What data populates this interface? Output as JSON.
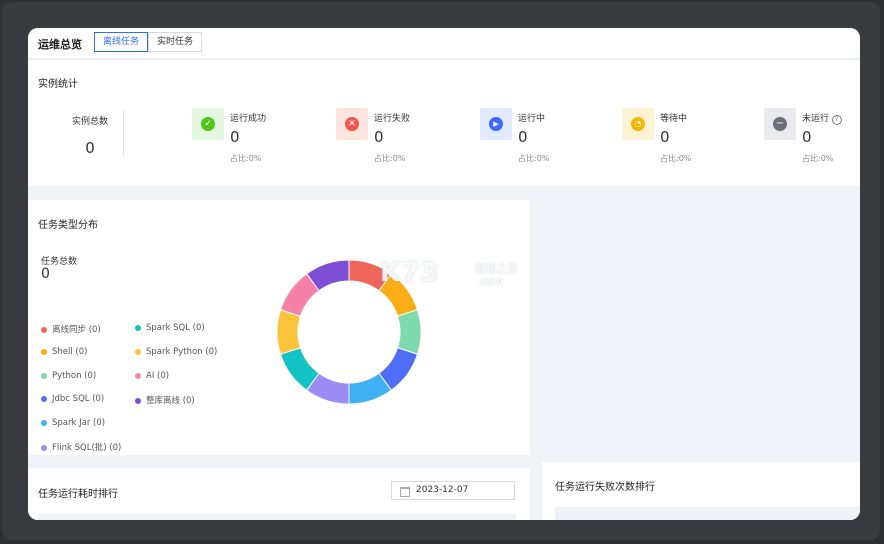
{
  "header": {
    "title": "运维总览",
    "tabs": [
      {
        "label": "离线任务",
        "active": true
      },
      {
        "label": "实时任务",
        "active": false
      }
    ]
  },
  "stats": {
    "title": "实例统计",
    "total_label": "实例总数",
    "total_value": "0",
    "items": [
      {
        "name": "运行成功",
        "value": "0",
        "ratio": "占比:0%",
        "icon": "check-icon",
        "bg": "#e6f7e1",
        "color": "#52c41a"
      },
      {
        "name": "运行失败",
        "value": "0",
        "ratio": "占比:0%",
        "icon": "close-icon",
        "bg": "#fde4e1",
        "color": "#f5564a"
      },
      {
        "name": "运行中",
        "value": "0",
        "ratio": "占比:0%",
        "icon": "play-icon",
        "bg": "#e3e9ff",
        "color": "#3d6bff"
      },
      {
        "name": "等待中",
        "value": "0",
        "ratio": "占比:0%",
        "icon": "clock-icon",
        "bg": "#fff3d6",
        "color": "#f7b500"
      },
      {
        "name": "未运行",
        "value": "0",
        "ratio": "占比:0%",
        "icon": "minus-icon",
        "bg": "#e9eaed",
        "color": "#6b6f78"
      }
    ]
  },
  "distribution": {
    "title": "任务类型分布",
    "total_label": "任务总数",
    "total_value": "0",
    "legend": [
      {
        "label": "离线同步 (0)",
        "color": "#f0655a"
      },
      {
        "label": "Spark SQL (0)",
        "color": "#13c2c2"
      },
      {
        "label": "Shell (0)",
        "color": "#faad14"
      },
      {
        "label": "Spark Python (0)",
        "color": "#fcc43c"
      },
      {
        "label": "Python (0)",
        "color": "#7ed9ad"
      },
      {
        "label": "AI (0)",
        "color": "#f580a8"
      },
      {
        "label": "Jdbc SQL (0)",
        "color": "#4d6ef5"
      },
      {
        "label": "整库离线 (0)",
        "color": "#7e4fd6"
      },
      {
        "label": "Spark Jar (0)",
        "color": "#40b0f5"
      },
      {
        "label": "Flink SQL(批) (0)",
        "color": "#9b8cf5"
      }
    ],
    "ring_colors": [
      "#f0655a",
      "#faad14",
      "#7ed9ad",
      "#4d6ef5",
      "#40b0f5",
      "#9b8cf5",
      "#13c2c2",
      "#fcc43c",
      "#f580a8",
      "#7e4fd6"
    ]
  },
  "watermark": {
    "main": "K73",
    "sub1": "游戏之家",
    "sub2": ".com"
  },
  "rank_duration": {
    "title": "任务运行耗时排行",
    "date": "2023-12-07"
  },
  "rank_failure": {
    "title": "任务运行失败次数排行"
  }
}
